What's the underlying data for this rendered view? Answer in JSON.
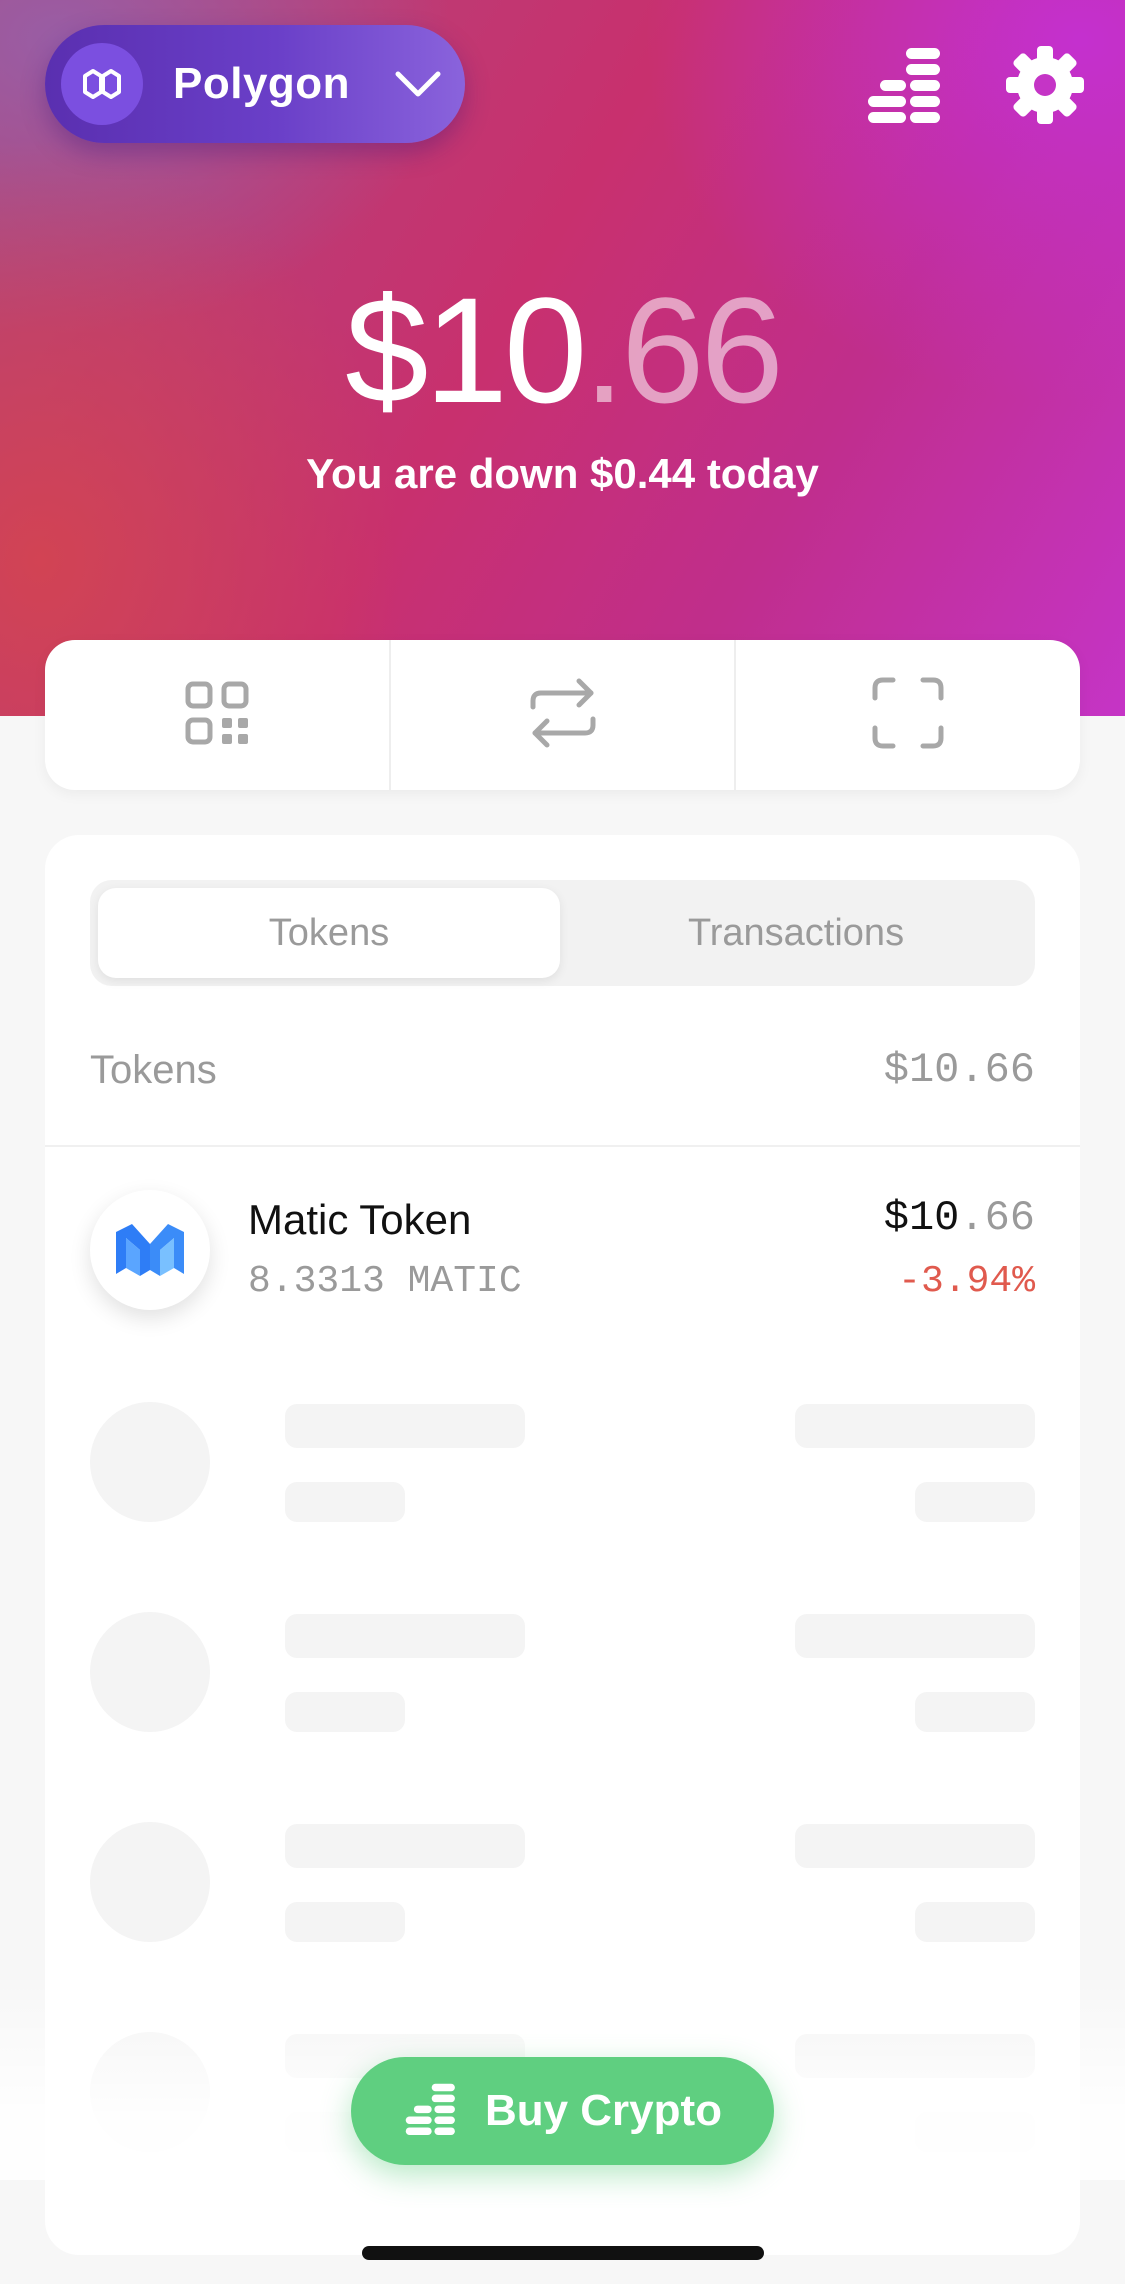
{
  "header": {
    "network": {
      "name": "Polygon",
      "logo_icon": "polygon-logo-icon",
      "dropdown_icon": "chevron-down-icon"
    },
    "icons": [
      "stack-coins-icon",
      "gear-icon"
    ]
  },
  "balance": {
    "whole": "$10",
    "cents": ".66",
    "change_text": "You are down $0.44 today"
  },
  "actions": [
    {
      "icon": "qr-code-icon"
    },
    {
      "icon": "swap-arrows-icon"
    },
    {
      "icon": "scan-frame-icon"
    }
  ],
  "tabs": {
    "tokens": "Tokens",
    "transactions": "Transactions",
    "selected": "Tokens"
  },
  "tokens_section": {
    "label": "Tokens",
    "total": "$10.66"
  },
  "tokens": [
    {
      "name": "Matic Token",
      "amount": "8.3313 MATIC",
      "value_whole": "$10",
      "value_cents": ".66",
      "change": "-3.94%",
      "logo_icon": "matic-logo-icon"
    }
  ],
  "buy_button": {
    "label": "Buy Crypto",
    "icon": "stack-coins-icon"
  },
  "colors": {
    "accent_purple": "#6a3fc8",
    "buy_green": "#5fcf80",
    "negative_red": "#e05a4e"
  }
}
